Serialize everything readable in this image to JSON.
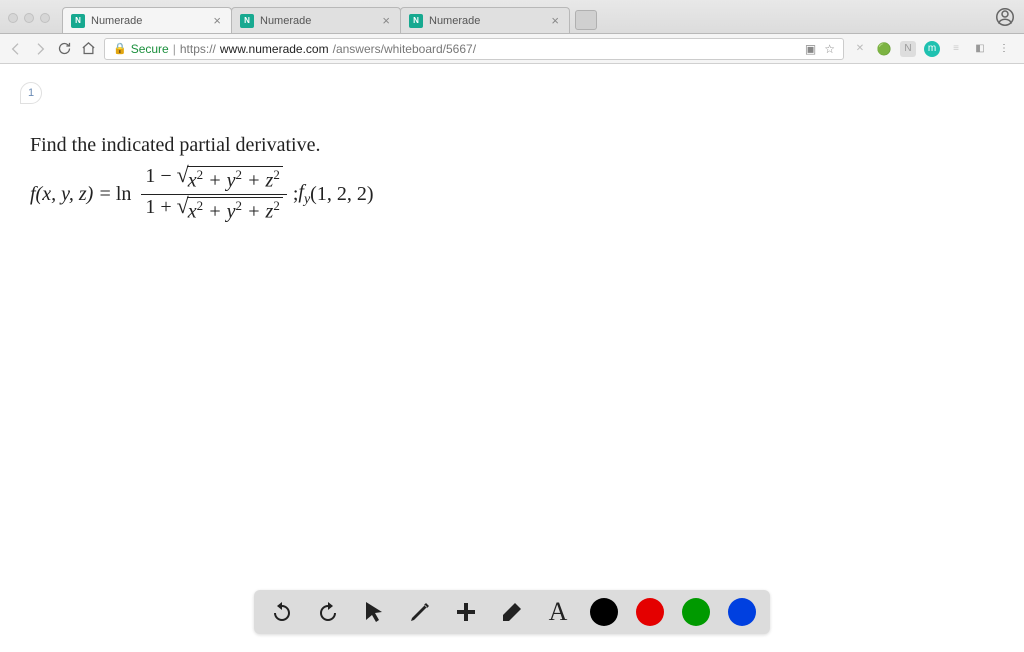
{
  "browser": {
    "tabs": [
      {
        "title": "Numerade",
        "active": true
      },
      {
        "title": "Numerade",
        "active": false
      },
      {
        "title": "Numerade",
        "active": false
      }
    ],
    "secure_label": "Secure",
    "url_scheme": "https://",
    "url_host": "www.numerade.com",
    "url_path": "/answers/whiteboard/5667/"
  },
  "page": {
    "number": "1",
    "problem_title": "Find the indicated partial derivative.",
    "math": {
      "lhs_open": "f(x, y, z) = ",
      "ln": "ln",
      "one_minus": "1 − ",
      "one_plus": "1 + ",
      "radicand": "x² + y² + z²",
      "semicolon": "; ",
      "fy": "f",
      "fy_sub": "y",
      "point": "(1, 2, 2)"
    }
  },
  "toolbar": {
    "tools": [
      "undo",
      "redo",
      "pointer",
      "pencil",
      "add",
      "eraser",
      "text"
    ],
    "colors": [
      "#000000",
      "#e40000",
      "#009a00",
      "#0040e0"
    ]
  }
}
